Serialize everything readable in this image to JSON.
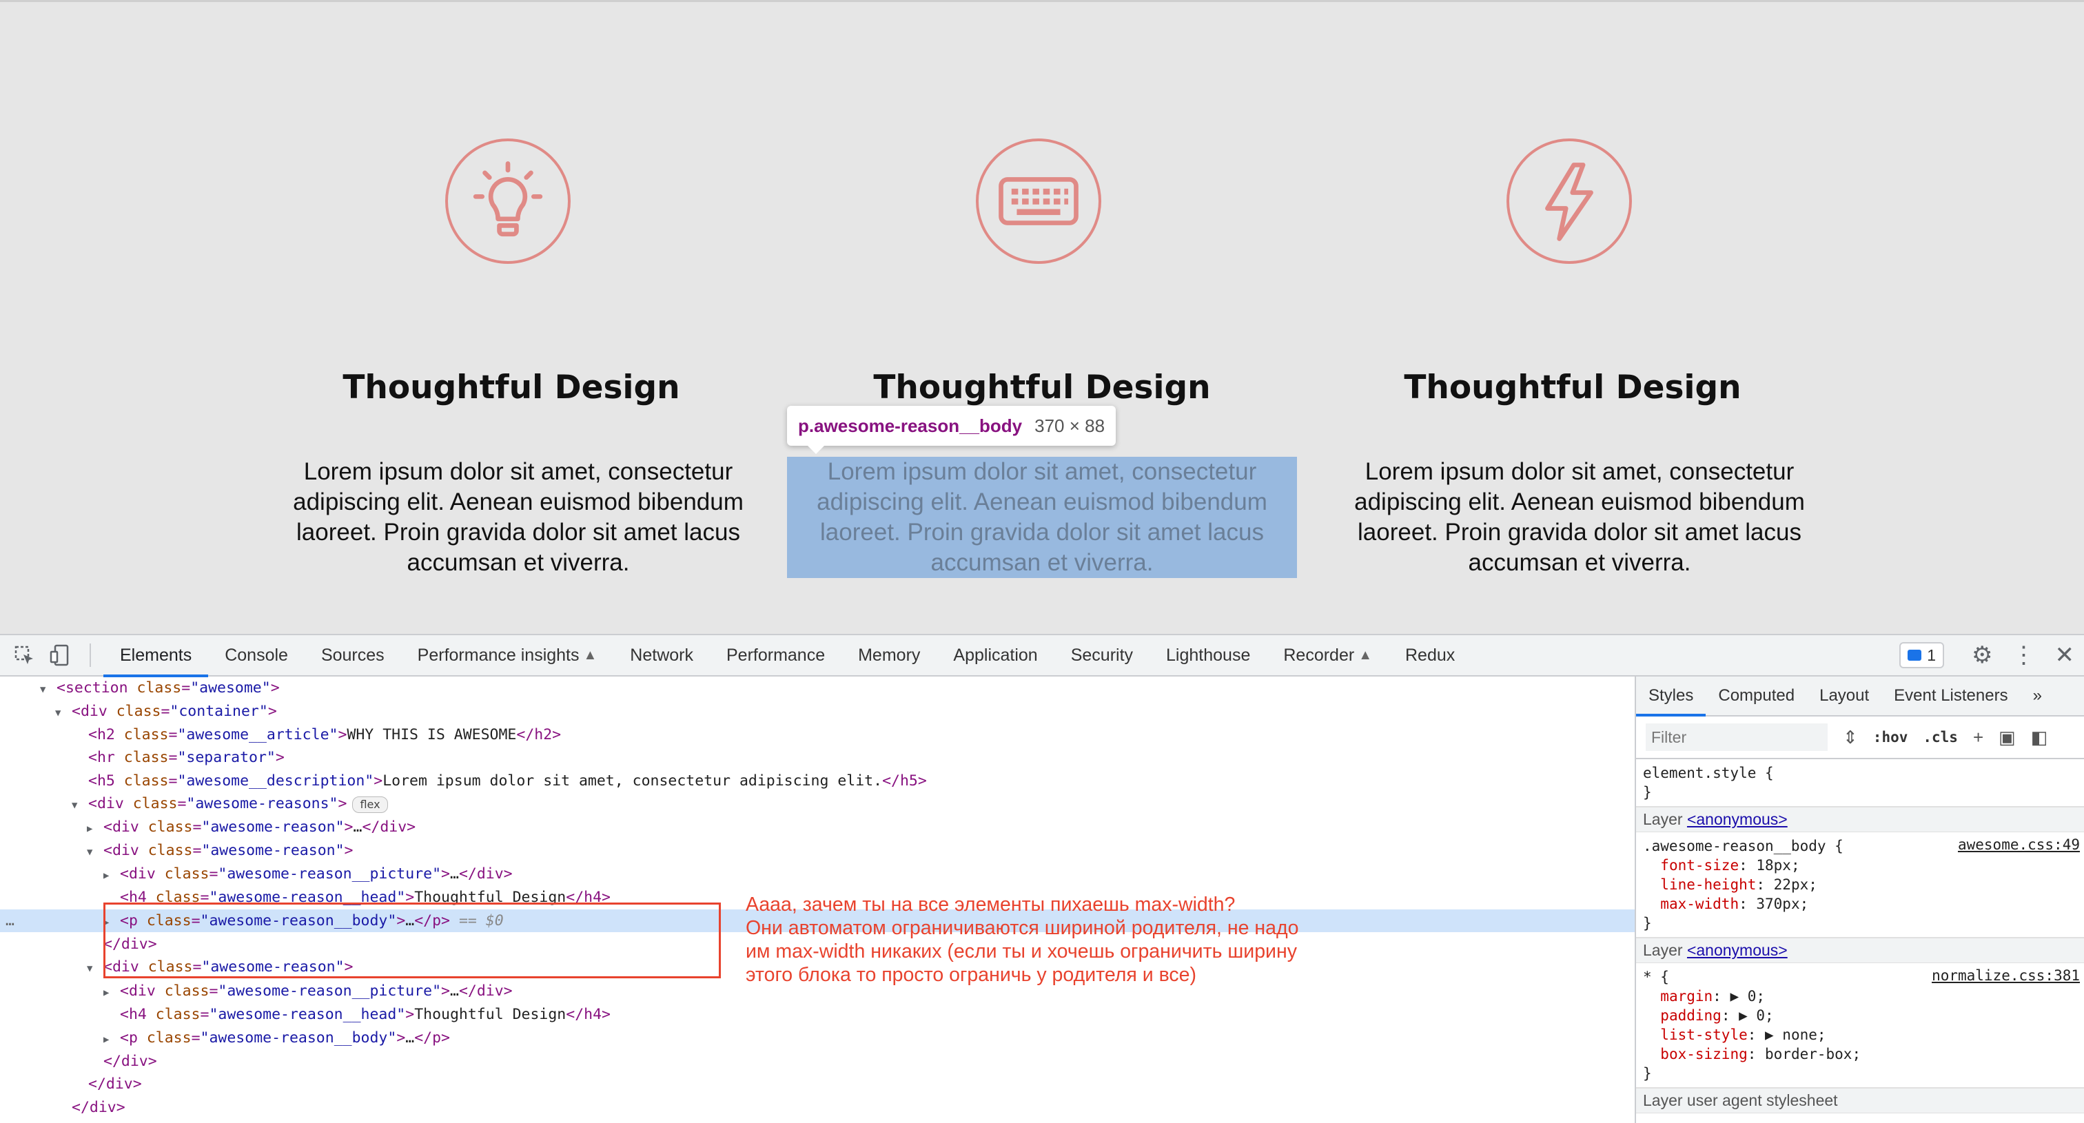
{
  "page": {
    "reasons": [
      {
        "title": "Thoughtful Design",
        "body": "Lorem ipsum dolor sit amet, consectetur adipiscing elit. Aenean euismod bibendum laoreet. Proin gravida dolor sit amet lacus accumsan et viverra.",
        "icon": "lightbulb-icon"
      },
      {
        "title": "Thoughtful Design",
        "body": "Lorem ipsum dolor sit amet, consectetur adipiscing elit. Aenean euismod bibendum laoreet. Proin gravida dolor sit amet lacus accumsan et viverra.",
        "icon": "keyboard-icon"
      },
      {
        "title": "Thoughtful Design",
        "body": "Lorem ipsum dolor sit amet, consectetur adipiscing elit. Aenean euismod bibendum laoreet. Proin gravida dolor sit amet lacus accumsan et viverra.",
        "icon": "lightning-icon"
      }
    ],
    "accent_color": "#e08a86",
    "inspect_tooltip": {
      "selector": "p.awesome-reason__body",
      "size": "370 × 88"
    }
  },
  "devtools": {
    "tabs": [
      "Elements",
      "Console",
      "Sources",
      "Performance insights",
      "Network",
      "Performance",
      "Memory",
      "Application",
      "Security",
      "Lighthouse",
      "Recorder",
      "Redux"
    ],
    "active_tab": "Elements",
    "issues_count": "1",
    "dom": [
      {
        "tri": "▼",
        "tag": "section",
        "cls": "awesome",
        "rest": ""
      },
      {
        "tri": "▼",
        "tag": "div",
        "cls": "container",
        "rest": ""
      },
      {
        "tri": "",
        "tag": "h2",
        "cls": "awesome__article",
        "text": "WHY THIS IS AWESOME",
        "close": "h2"
      },
      {
        "tri": "",
        "tag": "hr",
        "cls": "separator"
      },
      {
        "tri": "",
        "tag": "h5",
        "cls": "awesome__description",
        "text": "Lorem ipsum dolor sit amet, consectetur adipiscing elit.",
        "close": "h5"
      },
      {
        "tri": "▼",
        "tag": "div",
        "cls": "awesome-reasons",
        "badge": "flex"
      },
      {
        "tri": "▶",
        "tag": "div",
        "cls": "awesome-reason",
        "text": "…",
        "close": "div"
      },
      {
        "tri": "▼",
        "tag": "div",
        "cls": "awesome-reason"
      },
      {
        "tri": "▶",
        "tag": "div",
        "cls": "awesome-reason__picture",
        "text": "…",
        "close": "div"
      },
      {
        "tri": "",
        "tag": "h4",
        "cls": "awesome-reason__head",
        "text": "Thoughtful Design",
        "close": "h4"
      },
      {
        "tri": "▶",
        "tag": "p",
        "cls": "awesome-reason__body",
        "text": "…",
        "close": "p",
        "suffix": " == $0"
      },
      {
        "tri": "",
        "closeonly": "div"
      },
      {
        "tri": "▼",
        "tag": "div",
        "cls": "awesome-reason"
      },
      {
        "tri": "▶",
        "tag": "div",
        "cls": "awesome-reason__picture",
        "text": "…",
        "close": "div"
      },
      {
        "tri": "",
        "tag": "h4",
        "cls": "awesome-reason__head",
        "text": "Thoughtful Design",
        "close": "h4"
      },
      {
        "tri": "▶",
        "tag": "p",
        "cls": "awesome-reason__body",
        "text": "…",
        "close": "p"
      },
      {
        "tri": "",
        "closeonly": "div"
      },
      {
        "tri": "",
        "closeonly": "div"
      },
      {
        "tri": "",
        "closeonly": "div"
      },
      {
        "tri": "",
        "closeonly": "section"
      }
    ],
    "annotation": [
      "Аааа, зачем ты на все элементы пихаешь max-width?",
      "Они автоматом ограничиваются шириной родителя, не надо",
      "им max-width никаких (если ты и хочешь ограничить ширину",
      "этого блока то просто ограничь у родителя и все)"
    ],
    "styles": {
      "tabs": [
        "Styles",
        "Computed",
        "Layout",
        "Event Listeners"
      ],
      "filter_placeholder": "Filter",
      "hov": ":hov",
      "cls": ".cls",
      "element_style": "element.style {",
      "layer_label": "Layer",
      "layer_anon": "<anonymous>",
      "rule1": {
        "selector": ".awesome-reason__body {",
        "source": "awesome.css:49",
        "props": [
          [
            "font-size",
            "18px;"
          ],
          [
            "line-height",
            "22px;"
          ],
          [
            "max-width",
            "370px;"
          ]
        ]
      },
      "rule2": {
        "selector": "* {",
        "source": "normalize.css:381",
        "props": [
          [
            "margin",
            "▶ 0;"
          ],
          [
            "padding",
            "▶ 0;"
          ],
          [
            "list-style",
            "▶ none;"
          ],
          [
            "box-sizing",
            "border-box;"
          ]
        ]
      },
      "ua_layer": "Layer user agent stylesheet"
    }
  }
}
